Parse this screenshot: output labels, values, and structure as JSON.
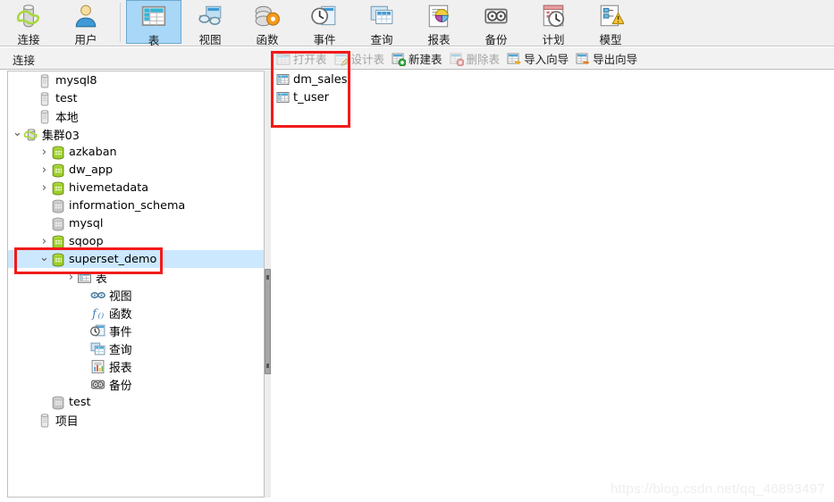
{
  "app": {
    "watermark": "https://blog.csdn.net/qq_46893497",
    "accent_red": "#f21b1b",
    "selection_blue": "#cce8ff",
    "ribbon_selected_blue": "#a8d7f7"
  },
  "ribbon": {
    "groups": [
      {
        "buttons": [
          {
            "label": "连接",
            "icon": "connection-icon",
            "selected": false
          },
          {
            "label": "用户",
            "icon": "user-icon",
            "selected": false
          }
        ]
      },
      {
        "buttons": [
          {
            "label": "表",
            "icon": "table-icon",
            "selected": true
          },
          {
            "label": "视图",
            "icon": "view-icon",
            "selected": false
          },
          {
            "label": "函数",
            "icon": "function-icon",
            "selected": false
          },
          {
            "label": "事件",
            "icon": "event-icon",
            "selected": false
          },
          {
            "label": "查询",
            "icon": "query-icon",
            "selected": false
          },
          {
            "label": "报表",
            "icon": "report-icon",
            "selected": false
          },
          {
            "label": "备份",
            "icon": "backup-icon",
            "selected": false
          },
          {
            "label": "计划",
            "icon": "schedule-icon",
            "selected": false
          },
          {
            "label": "模型",
            "icon": "model-icon",
            "selected": false
          }
        ]
      }
    ]
  },
  "subbar": {
    "left_label": "连接"
  },
  "table_toolbar": {
    "buttons": [
      {
        "label": "打开表",
        "icon": "open-table-icon",
        "disabled": true
      },
      {
        "label": "设计表",
        "icon": "design-table-icon",
        "disabled": true
      },
      {
        "label": "新建表",
        "icon": "new-table-icon",
        "disabled": false
      },
      {
        "label": "删除表",
        "icon": "delete-table-icon",
        "disabled": true
      },
      {
        "label": "导入向导",
        "icon": "import-wizard-icon",
        "disabled": false
      },
      {
        "label": "导出向导",
        "icon": "export-wizard-icon",
        "disabled": false
      }
    ]
  },
  "tree": {
    "items": [
      {
        "label": "mysql8",
        "icon": "server-offline-icon",
        "indent": 1,
        "arrow": "",
        "selected": false
      },
      {
        "label": "test",
        "icon": "server-offline-icon",
        "indent": 1,
        "arrow": "",
        "selected": false
      },
      {
        "label": "本地",
        "icon": "server-offline-icon",
        "indent": 1,
        "arrow": "",
        "selected": false
      },
      {
        "label": "集群03",
        "icon": "server-online-icon",
        "indent": 0,
        "arrow": "open",
        "selected": false
      },
      {
        "label": "azkaban",
        "icon": "db-green-icon",
        "indent": 2,
        "arrow": "closed",
        "selected": false
      },
      {
        "label": "dw_app",
        "icon": "db-green-icon",
        "indent": 2,
        "arrow": "closed",
        "selected": false
      },
      {
        "label": "hivemetadata",
        "icon": "db-green-icon",
        "indent": 2,
        "arrow": "closed",
        "selected": false
      },
      {
        "label": "information_schema",
        "icon": "db-gray-icon",
        "indent": 2,
        "arrow": "",
        "selected": false
      },
      {
        "label": "mysql",
        "icon": "db-gray-icon",
        "indent": 2,
        "arrow": "",
        "selected": false
      },
      {
        "label": "sqoop",
        "icon": "db-green-icon",
        "indent": 2,
        "arrow": "closed",
        "selected": false
      },
      {
        "label": "superset_demo",
        "icon": "db-green-icon",
        "indent": 2,
        "arrow": "open",
        "selected": true
      },
      {
        "label": "表",
        "icon": "table-icon",
        "indent": 4,
        "arrow": "closed",
        "selected": false
      },
      {
        "label": "视图",
        "icon": "view-icon",
        "indent": 5,
        "arrow": "",
        "selected": false
      },
      {
        "label": "函数",
        "icon": "function-icon",
        "indent": 5,
        "arrow": "",
        "selected": false
      },
      {
        "label": "事件",
        "icon": "event-icon",
        "indent": 5,
        "arrow": "",
        "selected": false
      },
      {
        "label": "查询",
        "icon": "query-icon",
        "indent": 5,
        "arrow": "",
        "selected": false
      },
      {
        "label": "报表",
        "icon": "report-icon",
        "indent": 5,
        "arrow": "",
        "selected": false
      },
      {
        "label": "备份",
        "icon": "backup-icon",
        "indent": 5,
        "arrow": "",
        "selected": false
      },
      {
        "label": "test",
        "icon": "db-gray-icon",
        "indent": 2,
        "arrow": "",
        "selected": false
      },
      {
        "label": "项目",
        "icon": "server-offline-icon",
        "indent": 1,
        "arrow": "",
        "selected": false
      }
    ]
  },
  "table_list": {
    "items": [
      {
        "label": "dm_sales",
        "icon": "table-icon"
      },
      {
        "label": "t_user",
        "icon": "table-icon"
      }
    ]
  }
}
